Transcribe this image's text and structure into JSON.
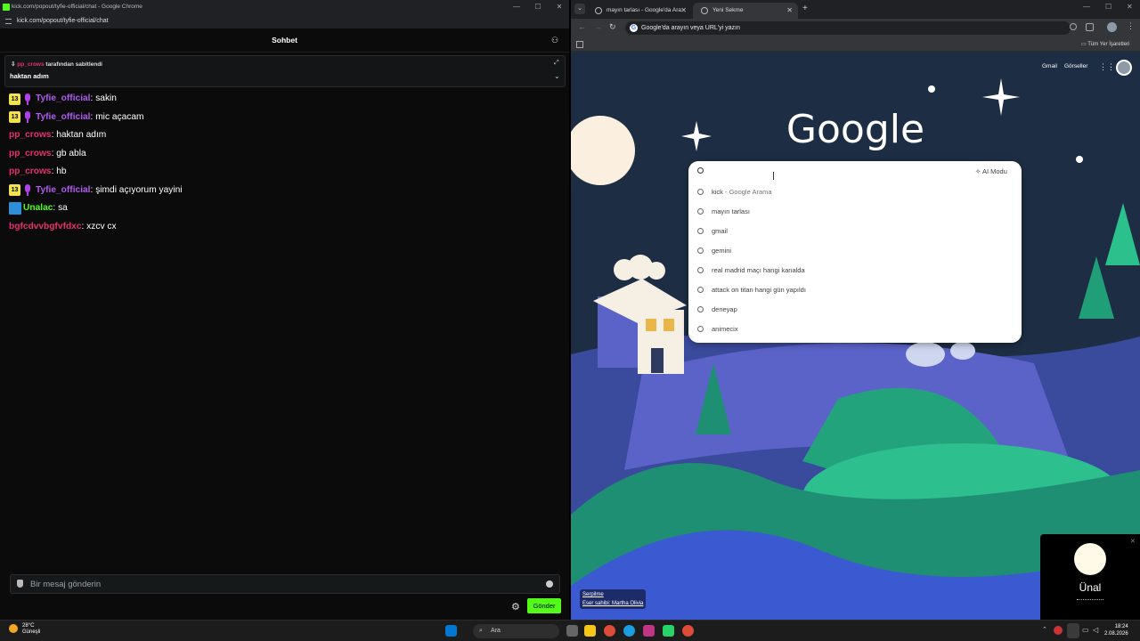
{
  "kick": {
    "window_title": "kick.com/popout/tyfie-official/chat - Google Chrome",
    "url": "kick.com/popout/tyfie-official/chat",
    "header": "Sohbet",
    "pinned": {
      "user": "pp_crows",
      "suffix": " tarafından sabitlendi",
      "text": "haktan adım"
    },
    "messages": [
      {
        "badge": "13",
        "mic": true,
        "user": "Tyfie_official",
        "color": "#b05cf0",
        "text": ": sakin"
      },
      {
        "badge": "13",
        "mic": true,
        "user": "Tyfie_official",
        "color": "#b05cf0",
        "text": ": mic açacam"
      },
      {
        "badge": "",
        "mic": false,
        "user": "pp_crows",
        "color": "#e7306b",
        "text": ": haktan adım"
      },
      {
        "badge": "",
        "mic": false,
        "user": "pp_crows",
        "color": "#e7306b",
        "text": ": gb abla"
      },
      {
        "badge": "",
        "mic": false,
        "user": "pp_crows",
        "color": "#e7306b",
        "text": ": hb"
      },
      {
        "badge": "13",
        "mic": true,
        "user": "Tyfie_official",
        "color": "#b05cf0",
        "text": ": şimdi açıyorum yayini"
      },
      {
        "badge": "",
        "mic": false,
        "icon": true,
        "user": "Unalac",
        "color": "#53fc18",
        "text": ": sa"
      },
      {
        "badge": "",
        "mic": false,
        "user": "bgfcdvvbgfvfdxc",
        "color": "#e7306b",
        "text": ": xzcv cx"
      }
    ],
    "input_placeholder": "Bir mesaj gönderin",
    "send_label": "Gönder"
  },
  "chrome": {
    "tabs": [
      {
        "label": "mayın tarlası - Google'da Ara"
      },
      {
        "label": "Yeni Sekme"
      }
    ],
    "omnibox": "Google'da arayın veya URL'yi yazın",
    "bookmarks_all": "Tüm Yer İşaretleri",
    "top_links": {
      "gmail": "Gmail",
      "images": "Görseller"
    },
    "logo": "Google",
    "ai_mode": "AI Modu",
    "suggestions": [
      {
        "text": "kick",
        "tail": " - Google Arama"
      },
      {
        "text": "mayın tarlası",
        "tail": ""
      },
      {
        "text": "gmail",
        "tail": ""
      },
      {
        "text": "gemini",
        "tail": ""
      },
      {
        "text": "real madrid maçı hangi kanalda",
        "tail": ""
      },
      {
        "text": "attack on titan hangi gün yapıldı",
        "tail": ""
      },
      {
        "text": "deneyap",
        "tail": ""
      },
      {
        "text": "animecix",
        "tail": ""
      }
    ],
    "credit_title": "Serpilme",
    "credit_author": "Eser sahibi: Martha Olivia"
  },
  "notification": {
    "name": "Ünal"
  },
  "taskbar": {
    "temp": "28°C",
    "weather": "Güneşli",
    "search": "Ara",
    "time": "18:24",
    "date": "2.08.2026"
  }
}
